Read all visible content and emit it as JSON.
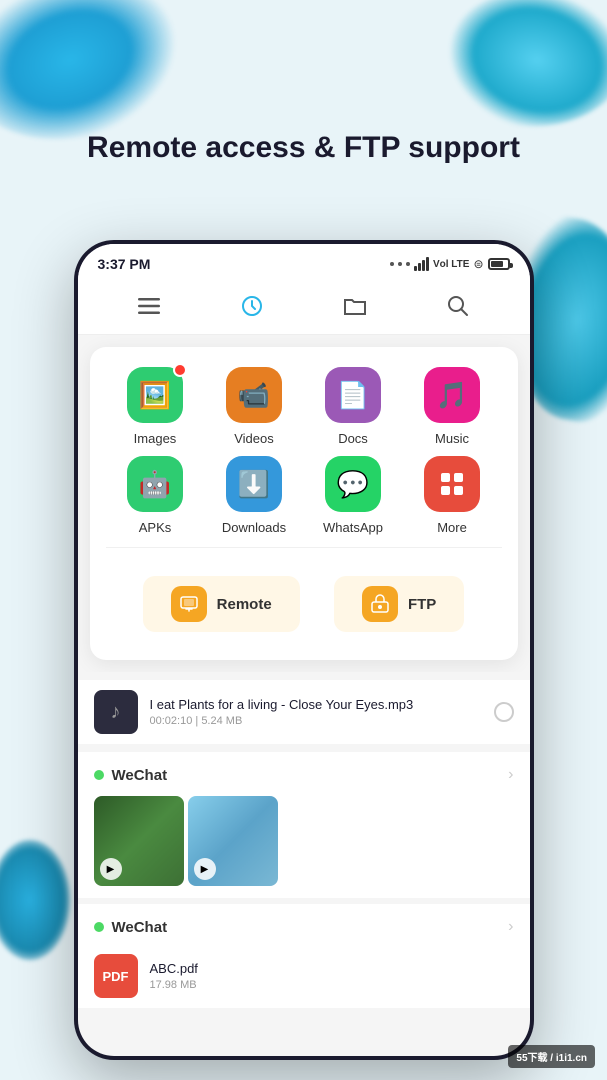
{
  "page": {
    "title": "Remote access & FTP support",
    "background_color": "#e8f4f8"
  },
  "status_bar": {
    "time": "3:37 PM",
    "signal": "Vоl LTE",
    "battery_pct": 70
  },
  "nav": {
    "menu_icon": "☰",
    "history_icon": "🕐",
    "folder_icon": "📁",
    "search_icon": "🔍"
  },
  "quick_access": {
    "items_row1": [
      {
        "label": "Images",
        "color": "#2ecc71",
        "icon": "🖼️"
      },
      {
        "label": "Videos",
        "color": "#e67e22",
        "icon": "📹"
      },
      {
        "label": "Docs",
        "color": "#9b59b6",
        "icon": "📄"
      },
      {
        "label": "Music",
        "color": "#e91e8c",
        "icon": "🎵"
      }
    ],
    "items_row2": [
      {
        "label": "APKs",
        "color": "#2ecc71",
        "icon": "🤖"
      },
      {
        "label": "Downloads",
        "color": "#3498db",
        "icon": "⬇️"
      },
      {
        "label": "WhatsApp",
        "color": "#25d366",
        "icon": "💬"
      },
      {
        "label": "More",
        "color": "#e74c3c",
        "icon": "⊞"
      }
    ]
  },
  "actions": {
    "remote": {
      "label": "Remote",
      "icon": "🖥️"
    },
    "ftp": {
      "label": "FTP",
      "icon": "📦"
    }
  },
  "file_list": {
    "music_item": {
      "name": "I eat Plants for a living - Close Your Eyes.mp3",
      "duration": "00:02:10",
      "size": "5.24 MB"
    },
    "sections": [
      {
        "name": "WeChat",
        "type": "images",
        "images": [
          "green-landscape",
          "blue-sky"
        ]
      },
      {
        "name": "WeChat",
        "type": "pdf",
        "pdf_name": "ABC.pdf",
        "pdf_size": "17.98 MB"
      }
    ]
  },
  "watermark": "55下载 / i1i1.cn"
}
